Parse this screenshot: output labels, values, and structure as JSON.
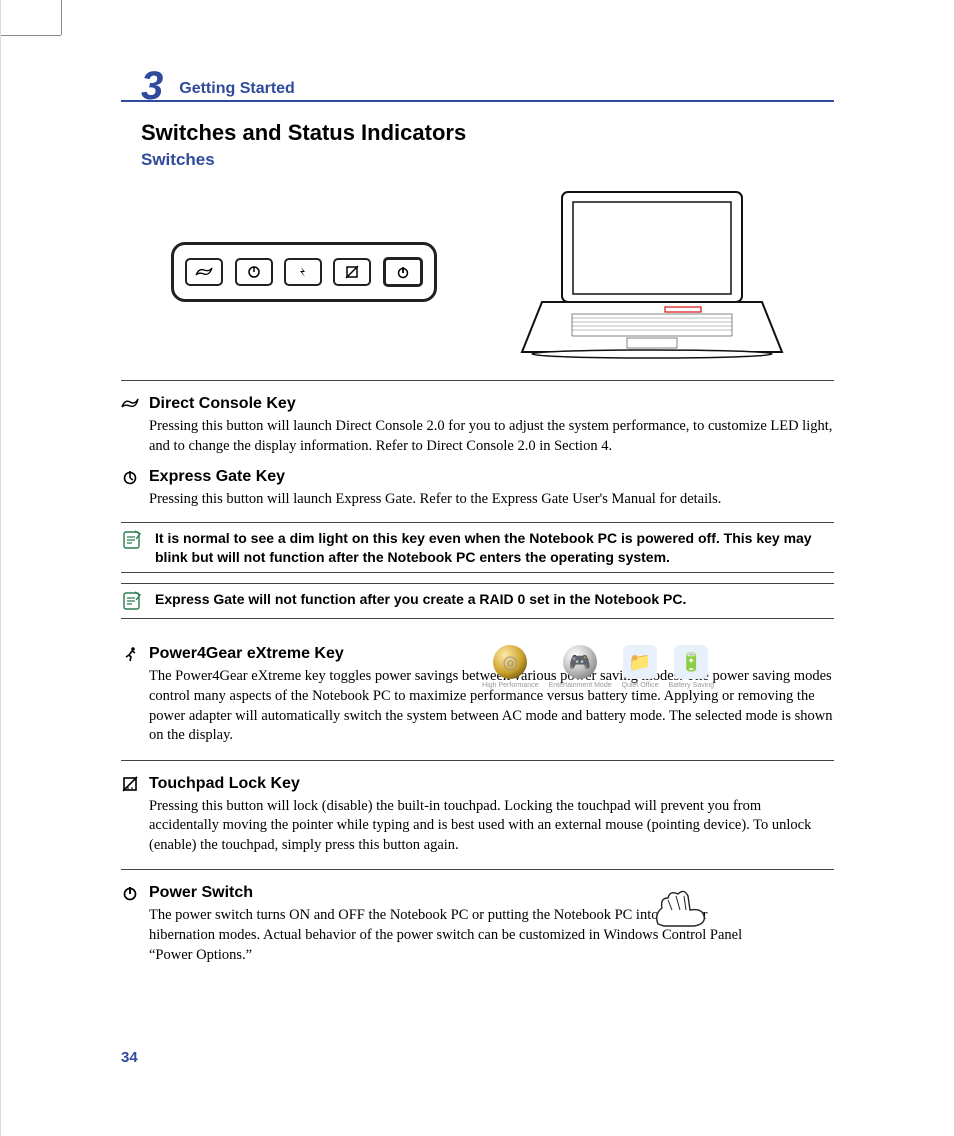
{
  "chapter": {
    "number": "3",
    "title": "Getting Started"
  },
  "section_title": "Switches and Status Indicators",
  "subsection": "Switches",
  "entries": {
    "direct_console": {
      "title": "Direct Console Key",
      "body": "Pressing this button will launch Direct Console 2.0 for you to adjust the system performance, to customize LED light, and to change the display information. Refer to Direct Console 2.0 in Section 4."
    },
    "express_gate": {
      "title": "Express Gate Key",
      "body": "Pressing this button will launch Express Gate. Refer to the Express Gate User's Manual for details."
    },
    "power4gear": {
      "title": "Power4Gear eXtreme Key",
      "body": "The Power4Gear eXtreme key toggles power savings between various power saving modes. The power saving modes control many aspects of the Notebook PC to maximize performance versus battery time. Applying or removing the power adapter will automatically switch the system between AC mode and battery mode. The selected mode is shown on the display."
    },
    "touchpad": {
      "title": "Touchpad Lock Key",
      "body": "Pressing this button will lock (disable) the built-in touchpad. Locking the touchpad will prevent you from accidentally moving the pointer while typing and is best used with an external mouse (pointing device). To unlock (enable) the touchpad, simply press this button again."
    },
    "power": {
      "title": "Power Switch",
      "body": "The power switch turns ON and OFF the Notebook PC or putting the Notebook PC into sleep or hibernation modes. Actual behavior of the power switch can be customized in Windows Control Panel “Power Options.”"
    }
  },
  "notes": {
    "note1": "It is normal to see a dim light on this key even when the Notebook PC is powered off. This key may blink but will not function after the Notebook PC enters the operating system.",
    "note2": "Express Gate will not function after you create a RAID 0 set in the Notebook PC."
  },
  "mode_labels": {
    "perf": "High Performance",
    "ent": "Entertainment Mode",
    "quiet": "Quiet Office",
    "batt": "Battery Saving"
  },
  "page_number": "34"
}
